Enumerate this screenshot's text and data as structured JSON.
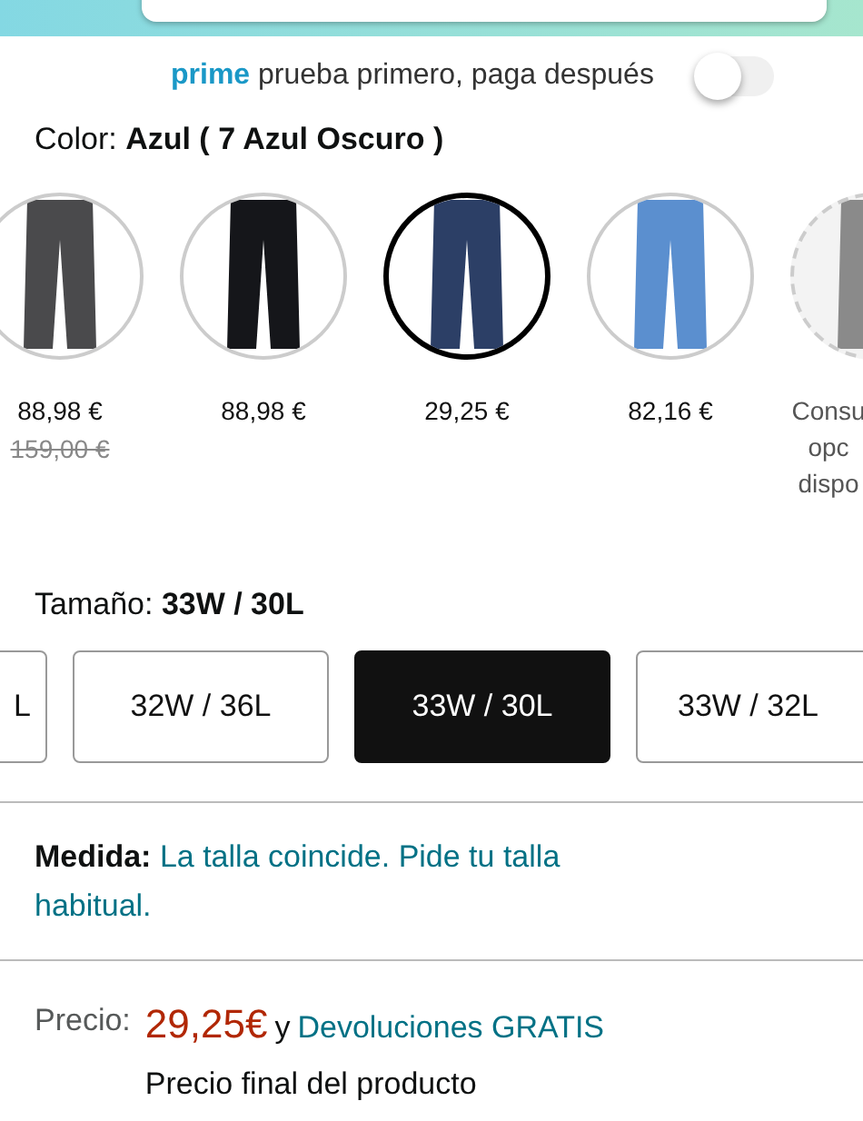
{
  "prime_trial": {
    "brand": "prime",
    "text": "prueba primero, paga después",
    "on": false
  },
  "color": {
    "label": "Color:",
    "value": "Azul ( 7 Azul Oscuro )"
  },
  "swatches": [
    {
      "kind": "available",
      "color": "#4a4a4c",
      "price": "88,98 €",
      "old_price": "159,00 €",
      "selected": false
    },
    {
      "kind": "available",
      "color": "#15161a",
      "price": "88,98 €",
      "selected": false
    },
    {
      "kind": "available",
      "color": "#2c3f66",
      "price": "29,25 €",
      "selected": true
    },
    {
      "kind": "available",
      "color": "#5b8fcf",
      "price": "82,16 €",
      "selected": false
    },
    {
      "kind": "unavailable",
      "color": "#8a8a8a",
      "price": "Consu opc dispo",
      "selected": false
    }
  ],
  "size": {
    "label": "Tamaño:",
    "value": "33W / 30L"
  },
  "sizes": [
    {
      "label": "L",
      "selected": false
    },
    {
      "label": "32W / 36L",
      "selected": false
    },
    {
      "label": "33W / 30L",
      "selected": true
    },
    {
      "label": "33W / 32L",
      "selected": false
    }
  ],
  "fit": {
    "label": "Medida:",
    "text": "La talla coincide. Pide tu talla habitual."
  },
  "price": {
    "label": "Precio:",
    "amount": "29,25€",
    "joiner": "y",
    "returns": "Devoluciones GRATIS",
    "note": "Precio final del producto"
  }
}
